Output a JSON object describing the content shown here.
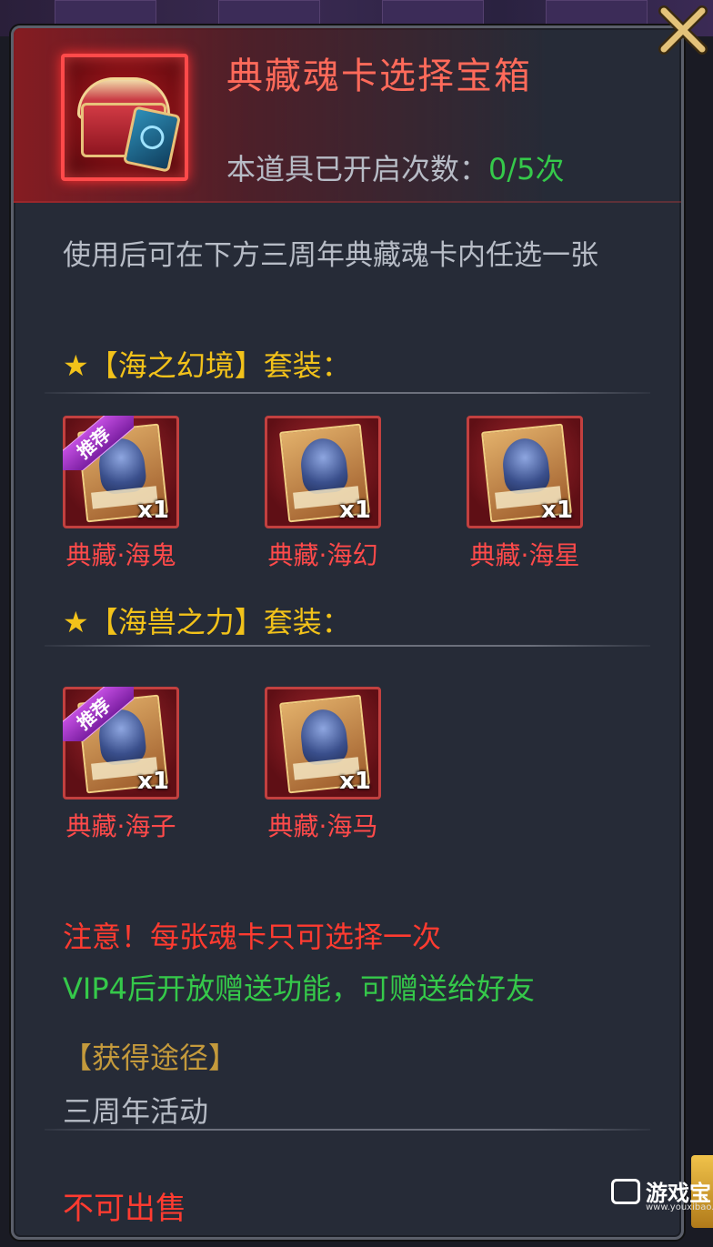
{
  "item": {
    "title": "典藏魂卡选择宝箱",
    "open_count_label": "本道具已开启次数：",
    "open_count_value": "0/5次",
    "description": "使用后可在下方三周年典藏魂卡内任选一张"
  },
  "sets": [
    {
      "title": "★【海之幻境】套装：",
      "cards": [
        {
          "name": "典藏·海鬼",
          "qty": "x1",
          "recommended": true
        },
        {
          "name": "典藏·海幻",
          "qty": "x1",
          "recommended": false
        },
        {
          "name": "典藏·海星",
          "qty": "x1",
          "recommended": false
        }
      ]
    },
    {
      "title": "★【海兽之力】套装：",
      "cards": [
        {
          "name": "典藏·海子",
          "qty": "x1",
          "recommended": true
        },
        {
          "name": "典藏·海马",
          "qty": "x1",
          "recommended": false
        }
      ]
    }
  ],
  "recommend_badge": "推荐",
  "notice": "注意！每张魂卡只可选择一次",
  "vip_note": "VIP4后开放赠送功能，可赠送给好友",
  "obtain": {
    "title": "【获得途径】",
    "value": "三周年活动"
  },
  "sell_status": "不可出售",
  "watermark": {
    "text": "游戏宝",
    "url": "www.youxibao.com"
  },
  "colors": {
    "title": "#ff6a5a",
    "count_value": "#35c94a",
    "set_title": "#f2c21a",
    "card_name": "#ff4a4a",
    "notice": "#ff3b30",
    "vip": "#35c94a",
    "obtain_title": "#c49a3c"
  },
  "icons": {
    "close": "close-x-icon",
    "chest": "treasure-chest-icon"
  }
}
